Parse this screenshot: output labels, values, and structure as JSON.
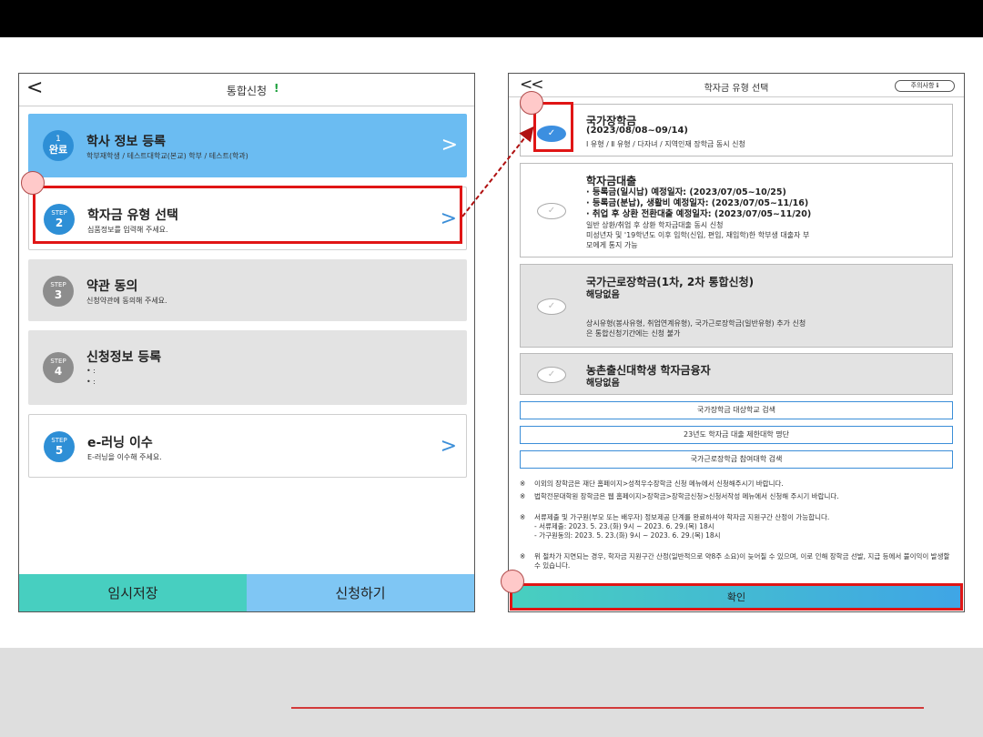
{
  "left_panel": {
    "back_glyph": "<",
    "title": "통합신청",
    "alert_mark": "!",
    "steps": [
      {
        "badge_top": "1",
        "badge_num": "완료",
        "title": "학사 정보 등록",
        "subtitle": "학부재학생 / 테스트대학교(본교) 학부 / 테스트(학과)"
      },
      {
        "badge_top": "STEP",
        "badge_num": "2",
        "title": "학자금 유형 선택",
        "subtitle": "심품정보를 입력해 주세요."
      },
      {
        "badge_top": "STEP",
        "badge_num": "3",
        "title": "약관 동의",
        "subtitle": "신청약관에 동의해 주세요."
      },
      {
        "badge_top": "STEP",
        "badge_num": "4",
        "title": "신청정보 등록",
        "subtitle": "• :",
        "subtitle2": "• :"
      },
      {
        "badge_top": "STEP",
        "badge_num": "5",
        "title": "e-러닝 이수",
        "subtitle": "E-러닝을 이수해 주세요."
      }
    ],
    "chevron": ">",
    "save_label": "임시저장",
    "apply_label": "신청하기"
  },
  "right_panel": {
    "back_glyph": "<<",
    "title": "학자금 유형 선택",
    "notice_label": "주의사항 ℹ",
    "check_glyph": "✓",
    "cards": [
      {
        "title": "국가장학금",
        "sub": "(2023/08/08~09/14)",
        "line": "Ⅰ 유형 / Ⅱ 유형 / 다자녀 / 지역인재 장학금 동시 신청",
        "checked": true
      },
      {
        "title": "학자금대출",
        "b1": "· 등록금(일시납) 예정일자: (2023/07/05~10/25)",
        "b2": "· 등록금(분납), 생활비 예정일자: (2023/07/05~11/16)",
        "b3": "· 취업 후 상환 전환대출 예정일자: (2023/07/05~11/20)",
        "n1": "일반 상환/취업 후 상환 학자금대출 동시 신청",
        "n2": "미성년자 및 '19학년도 이후 입학(신입, 편입, 재입학)한 학부생 대출자 부",
        "n3": "모에게 통지 가능",
        "checked": false
      },
      {
        "title": "국가근로장학금(1차, 2차 통합신청)",
        "sub": "해당없음",
        "n1": "상시유형(봉사유형, 취업연계유형), 국가근로장학금(일반유형) 추가 신청",
        "n2": "은 통합신청기간에는 신청 불가",
        "checked": false
      },
      {
        "title": "농촌출신대학생 학자금융자",
        "sub": "해당없음",
        "checked": false
      }
    ],
    "links": [
      "국가장학금 대상학교 검색",
      "23년도 학자금 대출 제한대학 명단",
      "국가근로장학금 참여대학 검색"
    ],
    "notes": [
      {
        "mark": "※",
        "text": "이외의 장학금은 재단 홈페이지>성적우수장학금 신청 메뉴에서 신청해주시기 바랍니다."
      },
      {
        "mark": "※",
        "text": "법학전문대학원 장학금은 웹 홈페이지>장학금>장학금신청>신청서작성 메뉴에서 신청해 주시기 바랍니다."
      },
      {
        "mark": "※",
        "text": "서류제출 및 가구원(부모 또는 배우자) 정보제공 단계를 완료하셔야 학자금 지원구간 산정이 가능합니다.",
        "sub1": "- 서류제출: 2023. 5. 23.(화) 9시 ~ 2023. 6. 29.(목) 18시",
        "sub2": "- 가구원동의: 2023. 5. 23.(화) 9시 ~ 2023. 6. 29.(목) 18시"
      },
      {
        "mark": "※",
        "text": "위 절차가 지연되는 경우, 학자금 지원구간 산정(일반적으로 약8주 소요)이 늦어질 수 있으며, 이로 인해 장학금 선발, 지급 등에서 불이익이 발생할 수 있습니다."
      }
    ],
    "confirm_label": "확인"
  },
  "colors": {
    "highlight_red": "#e01515",
    "accent_blue": "#2e8fd6",
    "teal": "#47cfc0",
    "marker_pink": "#ffc9c9"
  }
}
